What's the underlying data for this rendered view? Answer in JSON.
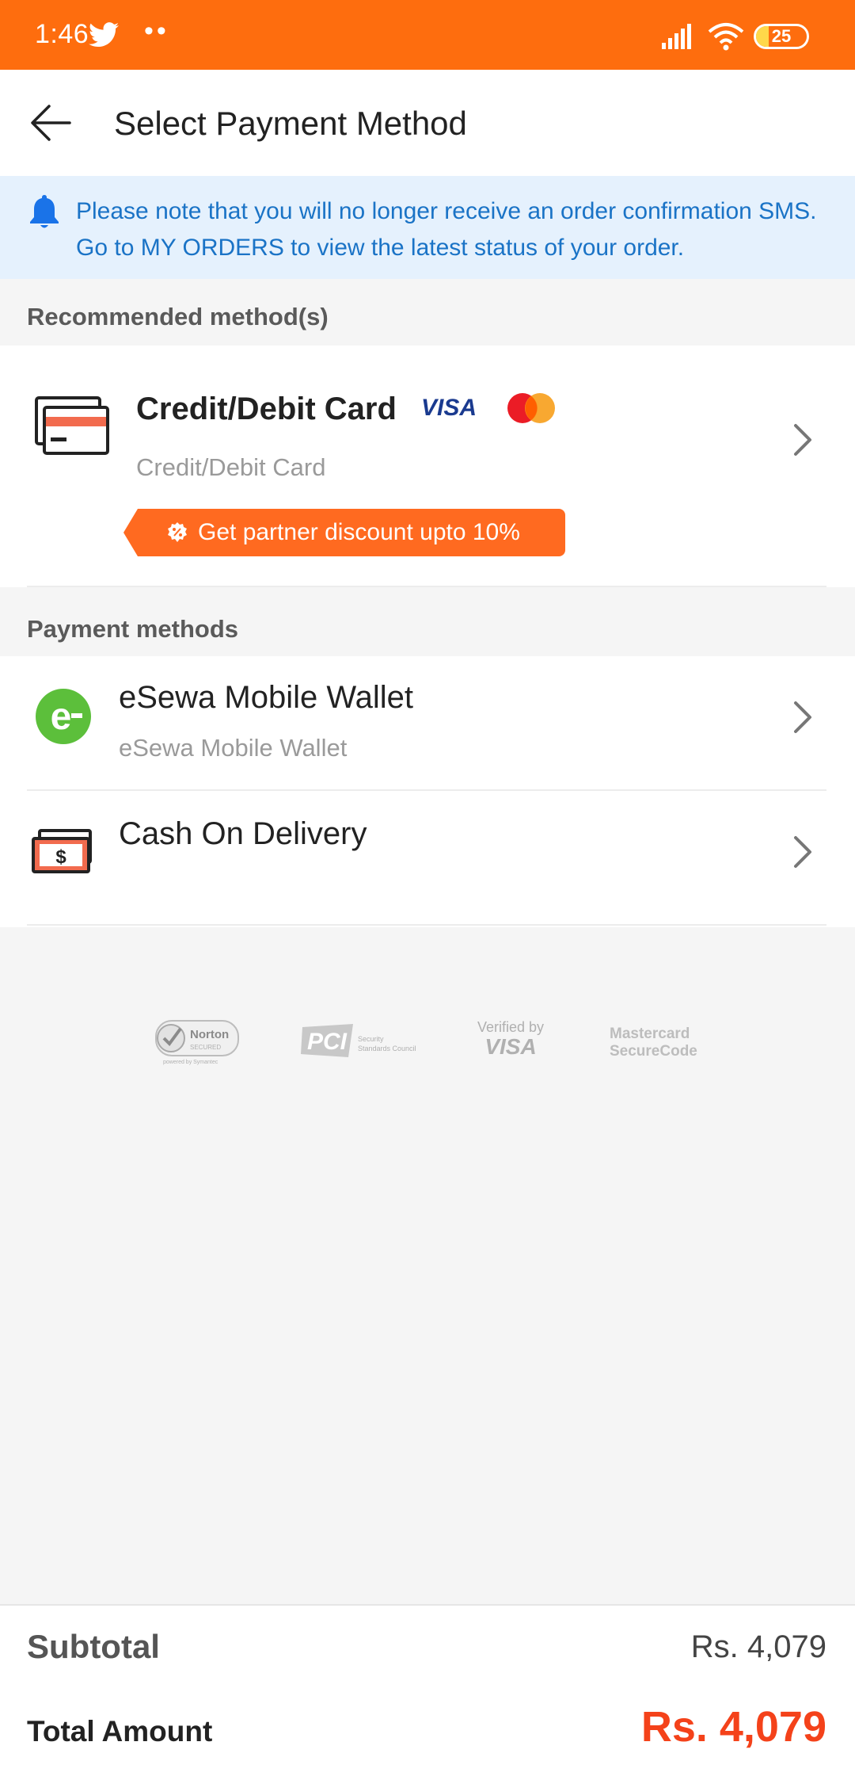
{
  "status_bar": {
    "time": "1:46",
    "dots": "••",
    "battery_level": "25",
    "battery_fraction": 0.25
  },
  "header": {
    "title": "Select Payment Method"
  },
  "notice": {
    "text": "Please note that you will no longer receive an order confirmation SMS. Go to MY ORDERS to view the latest status of your order."
  },
  "recommended": {
    "label": "Recommended method(s)",
    "method": {
      "name": "Credit/Debit Card",
      "subtitle": "Credit/Debit Card",
      "promo": "Get partner discount upto 10%"
    }
  },
  "payment_methods": {
    "label": "Payment methods",
    "items": [
      {
        "name": "eSewa Mobile Wallet",
        "subtitle": "eSewa Mobile Wallet"
      },
      {
        "name": "Cash On Delivery"
      }
    ]
  },
  "trust_badges": {
    "norton": "Norton",
    "norton_sub": "SECURED",
    "norton_by": "powered by Symantec",
    "pci": "PCI",
    "pci_sub1": "Security",
    "pci_sub2": "Standards Council",
    "visa_line1": "Verified by",
    "visa_line2": "VISA",
    "mc_line1": "Mastercard",
    "mc_line2": "SecureCode"
  },
  "summary": {
    "subtotal_label": "Subtotal",
    "subtotal_value": "Rs. 4,079",
    "total_label": "Total Amount",
    "total_value": "Rs. 4,079"
  },
  "colors": {
    "brand_orange": "#fe6d0e",
    "notice_bg": "#e5f1fd",
    "notice_text": "#1a73c6",
    "total_red": "#f4421a",
    "esewa_green": "#5cbf3b"
  }
}
